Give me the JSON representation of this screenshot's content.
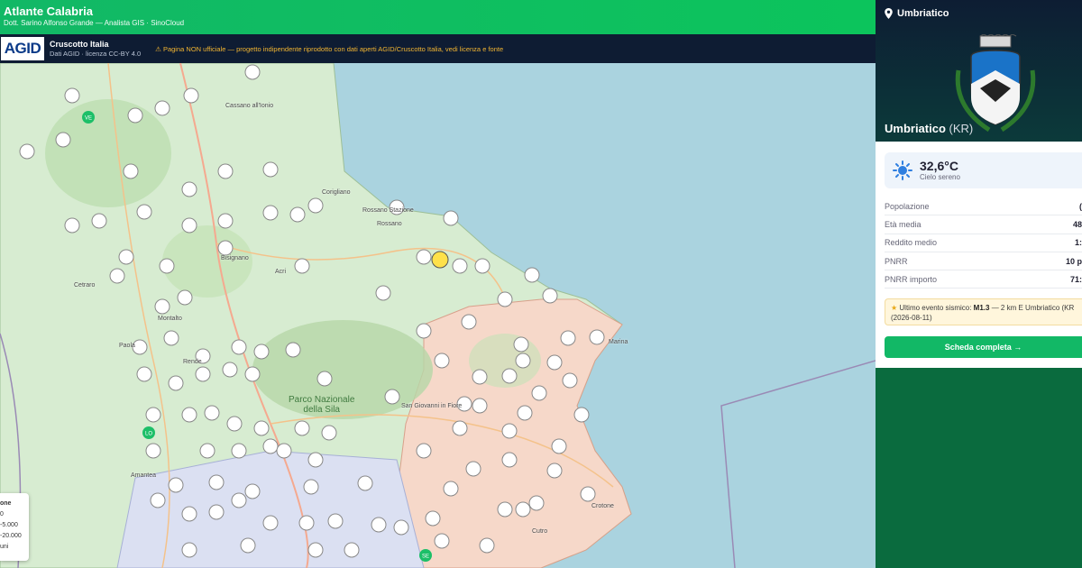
{
  "header": {
    "title": "Atlante Calabria",
    "subtitle": "Dott. Sarino Alfonso Grande — Analista GIS · SinoCloud"
  },
  "notice": {
    "logo": "AGID",
    "source_title": "Cruscotto Italia",
    "source_sub": "Dati AGID · licenza CC-BY 4.0",
    "warning": "⚠ Pagina NON ufficiale — progetto indipendente riprodotto con dati aperti AGID/Cruscotto Italia, vedi licenza e fonte"
  },
  "map": {
    "places": [
      "Cassano all'Ionio",
      "Rossano Stazione",
      "Rossano",
      "Bisignano",
      "Acri",
      "Cetraro",
      "Montalto",
      "Paola",
      "Rende",
      "San Giovanni in Fiore",
      "Crotone",
      "Amantea",
      "Cutro",
      "Marina",
      "Corigliano"
    ],
    "park_line1": "Parco Nazionale",
    "park_line2": "della Sila",
    "marker_badges": [
      "VE",
      "LO",
      "SE"
    ],
    "legend": [
      "one",
      "0",
      "-5.000",
      "-20.000",
      "uni"
    ]
  },
  "panel": {
    "location_label": "Umbriatico",
    "municipality": "Umbriatico",
    "province": "(KR)",
    "weather": {
      "temperature": "32,6°C",
      "condition": "Cielo sereno"
    },
    "stats": [
      {
        "label": "Popolazione",
        "value": "("
      },
      {
        "label": "Età media",
        "value": "48"
      },
      {
        "label": "Reddito medio",
        "value": "1:"
      },
      {
        "label": "PNRR",
        "value": "10 p"
      },
      {
        "label": "PNRR importo",
        "value": "71:"
      }
    ],
    "quake": {
      "prefix": "Ultimo evento sismico:",
      "magnitude": "M1.3",
      "detail": "— 2 km E Umbriatico (KR",
      "date": "(2026-08-11)"
    },
    "cta": "Scheda completa →"
  },
  "colors": {
    "header_green": "#0cc45c",
    "notice_bg": "#0e1c33",
    "warning": "#f2b531",
    "sea": "#aad3df",
    "land": "#d7ecd1",
    "crotone_region": "#f6d8c9"
  }
}
